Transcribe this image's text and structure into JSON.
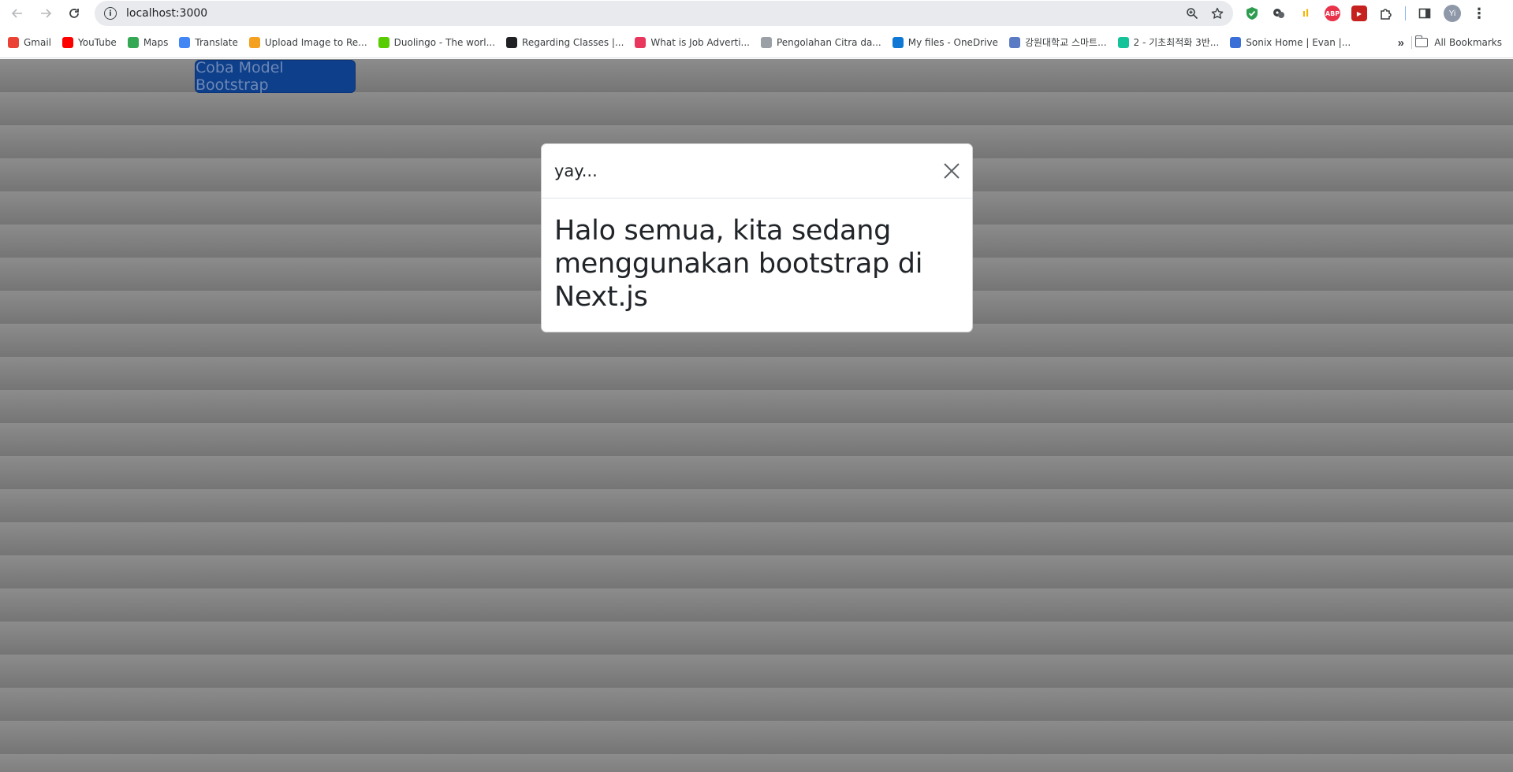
{
  "browser": {
    "url": "localhost:3000",
    "avatar_initials": "Yi",
    "bookmarks": [
      {
        "label": "Gmail",
        "icon": "gmail-icon",
        "color": "#ea4335"
      },
      {
        "label": "YouTube",
        "icon": "youtube-icon",
        "color": "#ff0000"
      },
      {
        "label": "Maps",
        "icon": "maps-icon",
        "color": "#34a853"
      },
      {
        "label": "Translate",
        "icon": "translate-icon",
        "color": "#4285f4"
      },
      {
        "label": "Upload Image to Re...",
        "icon": "upload-image-icon",
        "color": "#f4a020"
      },
      {
        "label": "Duolingo - The worl...",
        "icon": "duolingo-icon",
        "color": "#58cc02"
      },
      {
        "label": "Regarding Classes |...",
        "icon": "globe-icon",
        "color": "#202124"
      },
      {
        "label": "What is Job Adverti...",
        "icon": "job-ad-icon",
        "color": "#e8365d"
      },
      {
        "label": "Pengolahan Citra da...",
        "icon": "document-icon",
        "color": "#9aa0a6"
      },
      {
        "label": "My files - OneDrive",
        "icon": "onedrive-icon",
        "color": "#0f78d4"
      },
      {
        "label": "강원대학교 스마트...",
        "icon": "university-icon",
        "color": "#5a7bc4"
      },
      {
        "label": "2 - 기초최적화 3반...",
        "icon": "grammarly-icon",
        "color": "#15c39a"
      },
      {
        "label": "Sonix Home | Evan |...",
        "icon": "sonix-icon",
        "color": "#3b6fd8"
      }
    ],
    "all_bookmarks_label": "All Bookmarks"
  },
  "page": {
    "open_modal_button": "Coba Model Bootstrap"
  },
  "modal": {
    "title": "yay...",
    "body": "Halo semua, kita sedang menggunakan bootstrap di Next.js"
  }
}
